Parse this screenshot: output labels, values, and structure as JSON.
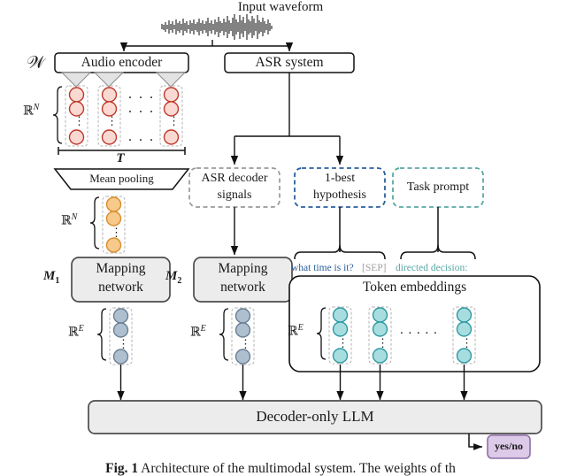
{
  "figure": {
    "input_label": "Input waveform",
    "caption_prefix": "Fig. 1",
    "caption_text": "Architecture of the multimodal system. The weights of th"
  },
  "blocks": {
    "audio_encoder": "Audio encoder",
    "asr_system": "ASR system",
    "mean_pooling": "Mean pooling",
    "asr_decoder_signals": "ASR decoder\nsignals",
    "asr_decoder_signals_line1": "ASR decoder",
    "asr_decoder_signals_line2": "signals",
    "one_best_line1": "1-best",
    "one_best_line2": "hypothesis",
    "task_prompt": "Task prompt",
    "mapping_network_line1": "Mapping",
    "mapping_network_line2": "network",
    "token_embeddings": "Token embeddings",
    "decoder_llm": "Decoder-only LLM",
    "output": "yes/no"
  },
  "math_labels": {
    "waveform_symbol": "𝒲",
    "dim_N_encoder": "ℝ",
    "dim_N_encoder_sup": "N",
    "seq_len_T": "T",
    "dim_N_pooled": "ℝ",
    "dim_N_pooled_sup": "N",
    "mapping_1": "M",
    "mapping_1_sub": "1",
    "mapping_2": "M",
    "mapping_2_sub": "2",
    "dim_E_1": "ℝ",
    "dim_E_1_sup": "E",
    "dim_E_2": "ℝ",
    "dim_E_2_sup": "E",
    "dim_E_3": "ℝ",
    "dim_E_3_sup": "E"
  },
  "tokens": {
    "hypothesis_text": "what time is it?",
    "separator_text": "[SEP]",
    "prompt_text": "directed decision:",
    "ellipsis": ". . . . ."
  },
  "ellipses": {
    "encoder_dots_row": ". . .",
    "vertical_dots": "⋮"
  },
  "colors": {
    "encoder_node_fill": "#f9d9d2",
    "encoder_node_stroke": "#c0392b",
    "pooled_node_fill": "#f7c98a",
    "pooled_node_stroke": "#d98c2b",
    "mapped_node_fill": "#aebfd0",
    "mapped_node_stroke": "#6b7f93",
    "token_node_fill": "#a8dde0",
    "token_node_stroke": "#2e9aa3",
    "hypothesis_border": "#2c5f9e",
    "prompt_border": "#5aa8a6",
    "decoder_signals_border": "#9a9a9a",
    "block_fill": "#ececec",
    "block_stroke": "#4d4d4d",
    "output_fill": "#ddc9e8",
    "output_stroke": "#8e6fa8",
    "hypothesis_text_color": "#2c5f9e",
    "separator_text_color": "#a0a0a0",
    "prompt_text_color": "#5aa8a6",
    "line_color": "#111111"
  }
}
